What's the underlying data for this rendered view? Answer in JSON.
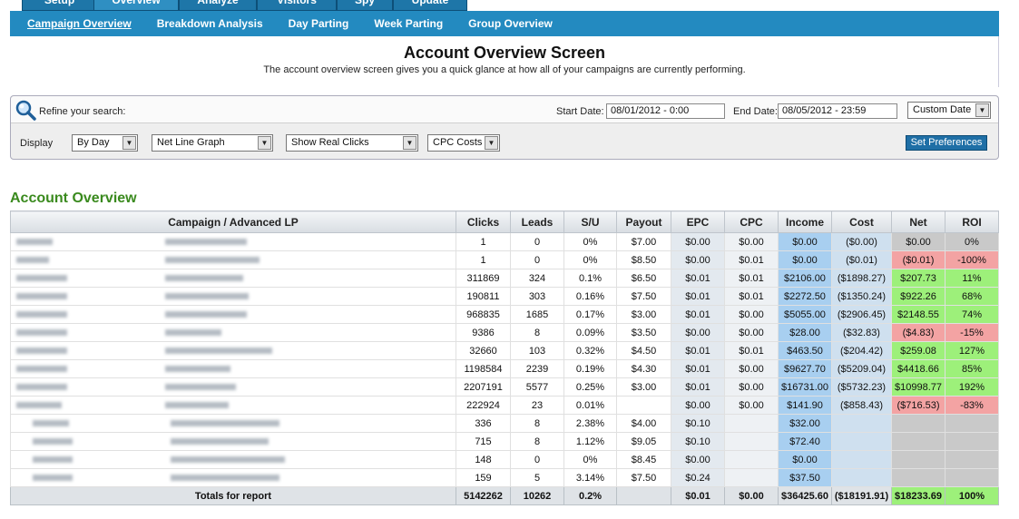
{
  "top_tabs": [
    "Setup",
    "Overview",
    "Analyze",
    "Visitors",
    "Spy",
    "Update"
  ],
  "subnav": [
    "Campaign Overview",
    "Breakdown Analysis",
    "Day Parting",
    "Week Parting",
    "Group Overview"
  ],
  "header": {
    "title": "Account Overview Screen",
    "subtitle": "The account overview screen gives you a quick glance at how all of your campaigns are currently performing."
  },
  "search": {
    "refine_label": "Refine your search:",
    "start_label": "Start Date:",
    "start_value": "08/01/2012 - 0:00",
    "end_label": "End Date:",
    "end_value": "08/05/2012 - 23:59",
    "range_select": "Custom Date",
    "display_label": "Display",
    "period_select": "By Day",
    "graph_select": "Net Line Graph",
    "clicks_select": "Show Real Clicks",
    "cost_select": "CPC Costs",
    "pref_button": "Set Preferences"
  },
  "section_title": "Account Overview",
  "table": {
    "headers": [
      "Campaign / Advanced LP",
      "Clicks",
      "Leads",
      "S/U",
      "Payout",
      "EPC",
      "CPC",
      "Income",
      "Cost",
      "Net",
      "ROI"
    ],
    "rows": [
      {
        "clicks": "1",
        "leads": "0",
        "su": "0%",
        "payout": "$7.00",
        "epc": "$0.00",
        "cpc": "$0.00",
        "income": "$0.00",
        "cost": "($0.00)",
        "net": "$0.00",
        "roi": "0%",
        "tone": "gray"
      },
      {
        "clicks": "1",
        "leads": "0",
        "su": "0%",
        "payout": "$8.50",
        "epc": "$0.00",
        "cpc": "$0.01",
        "income": "$0.00",
        "cost": "($0.01)",
        "net": "($0.01)",
        "roi": "-100%",
        "tone": "red"
      },
      {
        "clicks": "311869",
        "leads": "324",
        "su": "0.1%",
        "payout": "$6.50",
        "epc": "$0.01",
        "cpc": "$0.01",
        "income": "$2106.00",
        "cost": "($1898.27)",
        "net": "$207.73",
        "roi": "11%",
        "tone": "green"
      },
      {
        "clicks": "190811",
        "leads": "303",
        "su": "0.16%",
        "payout": "$7.50",
        "epc": "$0.01",
        "cpc": "$0.01",
        "income": "$2272.50",
        "cost": "($1350.24)",
        "net": "$922.26",
        "roi": "68%",
        "tone": "green"
      },
      {
        "clicks": "968835",
        "leads": "1685",
        "su": "0.17%",
        "payout": "$3.00",
        "epc": "$0.01",
        "cpc": "$0.00",
        "income": "$5055.00",
        "cost": "($2906.45)",
        "net": "$2148.55",
        "roi": "74%",
        "tone": "green"
      },
      {
        "clicks": "9386",
        "leads": "8",
        "su": "0.09%",
        "payout": "$3.50",
        "epc": "$0.00",
        "cpc": "$0.00",
        "income": "$28.00",
        "cost": "($32.83)",
        "net": "($4.83)",
        "roi": "-15%",
        "tone": "red"
      },
      {
        "clicks": "32660",
        "leads": "103",
        "su": "0.32%",
        "payout": "$4.50",
        "epc": "$0.01",
        "cpc": "$0.01",
        "income": "$463.50",
        "cost": "($204.42)",
        "net": "$259.08",
        "roi": "127%",
        "tone": "green"
      },
      {
        "clicks": "1198584",
        "leads": "2239",
        "su": "0.19%",
        "payout": "$4.30",
        "epc": "$0.01",
        "cpc": "$0.00",
        "income": "$9627.70",
        "cost": "($5209.04)",
        "net": "$4418.66",
        "roi": "85%",
        "tone": "green"
      },
      {
        "clicks": "2207191",
        "leads": "5577",
        "su": "0.25%",
        "payout": "$3.00",
        "epc": "$0.01",
        "cpc": "$0.00",
        "income": "$16731.00",
        "cost": "($5732.23)",
        "net": "$10998.77",
        "roi": "192%",
        "tone": "green"
      },
      {
        "clicks": "222924",
        "leads": "23",
        "su": "0.01%",
        "payout": "",
        "epc": "$0.00",
        "cpc": "$0.00",
        "income": "$141.90",
        "cost": "($858.43)",
        "net": "($716.53)",
        "roi": "-83%",
        "tone": "red"
      },
      {
        "clicks": "336",
        "leads": "8",
        "su": "2.38%",
        "payout": "$4.00",
        "epc": "$0.10",
        "cpc": "",
        "income": "$32.00",
        "cost": "",
        "net": "",
        "roi": "",
        "tone": "sub"
      },
      {
        "clicks": "715",
        "leads": "8",
        "su": "1.12%",
        "payout": "$9.05",
        "epc": "$0.10",
        "cpc": "",
        "income": "$72.40",
        "cost": "",
        "net": "",
        "roi": "",
        "tone": "sub"
      },
      {
        "clicks": "148",
        "leads": "0",
        "su": "0%",
        "payout": "$8.45",
        "epc": "$0.00",
        "cpc": "",
        "income": "$0.00",
        "cost": "",
        "net": "",
        "roi": "",
        "tone": "sub"
      },
      {
        "clicks": "159",
        "leads": "5",
        "su": "3.14%",
        "payout": "$7.50",
        "epc": "$0.24",
        "cpc": "",
        "income": "$37.50",
        "cost": "",
        "net": "",
        "roi": "",
        "tone": "sub"
      }
    ],
    "totals": {
      "label": "Totals for report",
      "clicks": "5142262",
      "leads": "10262",
      "su": "0.2%",
      "payout": "",
      "epc": "$0.01",
      "cpc": "$0.00",
      "income": "$36425.60",
      "cost": "($18191.91)",
      "net": "$18233.69",
      "roi": "100%"
    }
  }
}
